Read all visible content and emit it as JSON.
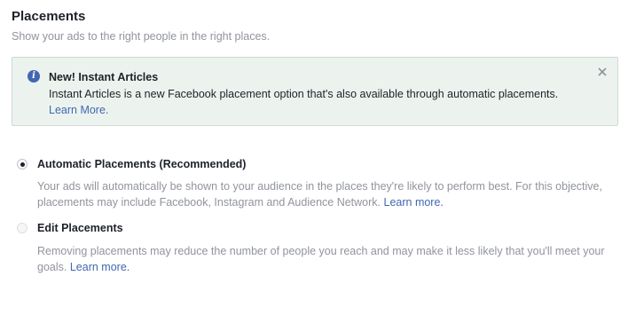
{
  "header": {
    "title": "Placements",
    "subtitle": "Show your ads to the right people in the right places."
  },
  "notice": {
    "icon": "info-icon",
    "title": "New! Instant Articles",
    "body": "Instant Articles is a new Facebook placement option that's also available through automatic placements.",
    "link": "Learn More.",
    "close_icon": "close-icon"
  },
  "options": [
    {
      "label": "Automatic Placements (Recommended)",
      "selected": true,
      "description": "Your ads will automatically be shown to your audience in the places they're likely to perform best. For this objective, placements may include Facebook, Instagram and Audience Network.",
      "link": "Learn more."
    },
    {
      "label": "Edit Placements",
      "selected": false,
      "description": "Removing placements may reduce the number of people you reach and may make it less likely that you'll meet your goals.",
      "link": "Learn more."
    }
  ],
  "colors": {
    "link": "#4267b2",
    "notice_background": "#ecf3ee",
    "muted_text": "#90949c"
  }
}
